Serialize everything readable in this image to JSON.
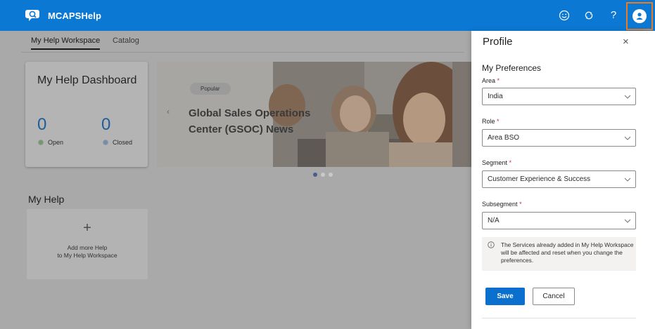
{
  "app": {
    "title": "MCAPSHelp"
  },
  "topbar": {
    "icons": [
      "smiley-feedback-icon",
      "sync-icon",
      "help-icon",
      "user-profile-icon"
    ],
    "help_glyph": "?",
    "accent_color": "#0b78d4",
    "profile_highlight_color": "#ee7b22"
  },
  "tabs": [
    {
      "label": "My Help Workspace",
      "active": true
    },
    {
      "label": "Catalog",
      "active": false
    }
  ],
  "dashboard": {
    "title": "My Help Dashboard",
    "open_count": "0",
    "open_label": "Open",
    "closed_count": "0",
    "closed_label": "Closed"
  },
  "hero": {
    "badge": "Popular",
    "title": "Global Sales Operations Center (GSOC) News",
    "prev_glyph": "‹",
    "slide_count": 3,
    "active_slide": 1
  },
  "my_help": {
    "title": "My Help",
    "add_glyph": "+",
    "add_line1": "Add more Help",
    "add_line2": "to My Help Workspace"
  },
  "profile": {
    "title": "Profile",
    "close_glyph": "×",
    "section_title": "My Preferences",
    "required_marker": "*",
    "fields": [
      {
        "label": "Area",
        "value": "India"
      },
      {
        "label": "Role",
        "value": "Area BSO"
      },
      {
        "label": "Segment",
        "value": "Customer Experience & Success"
      },
      {
        "label": "Subsegment",
        "value": "N/A"
      }
    ],
    "notice": "The Services already added in My Help Workspace will be affected and reset when you change the preferences.",
    "save_label": "Save",
    "cancel_label": "Cancel"
  }
}
